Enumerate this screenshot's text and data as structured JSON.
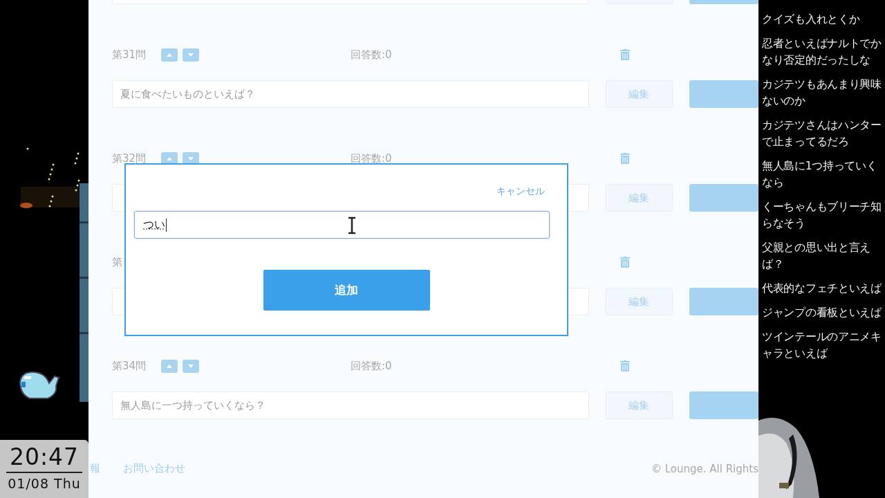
{
  "left_panel": {
    "clock": {
      "time": "20:47",
      "date": "01/08 Thu"
    }
  },
  "questions": [
    {
      "number": "第31問",
      "answers": "回答数:0",
      "text": "夏に食べたいものといえば？",
      "edit": "編集"
    },
    {
      "number": "第32問",
      "answers": "回答数:0",
      "edit": "編集"
    },
    {
      "number": "第",
      "edit": "編集"
    },
    {
      "number": "第34問",
      "answers": "回答数:0",
      "text": "無人島に一つ持っていくなら？",
      "edit": "編集"
    }
  ],
  "modal": {
    "cancel": "キャンセル",
    "input_value": "つい",
    "submit": "追加"
  },
  "footer": {
    "links": [
      "報",
      "お問い合わせ"
    ],
    "copyright": "© Lounge. All Rights"
  },
  "comments": [
    "クイズも入れとくか",
    "忍者といえばナルトでかなり否定的だったしな",
    "カジテツもあんまり興味ないのか",
    "カジテツさんはハンターで止まってるだろ",
    "無人島に1つ持っていくなら",
    "くーちゃんもブリーチ知らなそう",
    "父親との思い出と言えば？",
    "代表的なフェチといえば",
    "ジャンプの看板といえば",
    "ツインテールのアニメキャラといえば"
  ]
}
